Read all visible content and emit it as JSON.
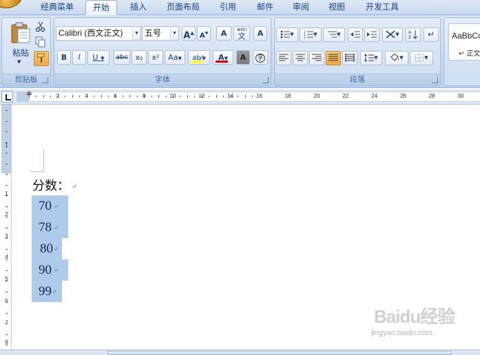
{
  "tabs": [
    {
      "label": "经典菜单",
      "active": false
    },
    {
      "label": "开始",
      "active": true
    },
    {
      "label": "插入",
      "active": false
    },
    {
      "label": "页面布局",
      "active": false
    },
    {
      "label": "引用",
      "active": false
    },
    {
      "label": "邮件",
      "active": false
    },
    {
      "label": "审阅",
      "active": false
    },
    {
      "label": "视图",
      "active": false
    },
    {
      "label": "开发工具",
      "active": false
    }
  ],
  "clipboard": {
    "group_label": "剪贴板",
    "paste_label": "粘贴",
    "icons": [
      "paste-icon",
      "cut-icon",
      "copy-icon",
      "format-painter-icon"
    ]
  },
  "font": {
    "group_label": "字体",
    "font_name": "Calibri (西文正文)",
    "font_size": "五号",
    "grow_label": "A",
    "shrink_label": "A",
    "clear_format_label": "A",
    "phonetic_label": "文",
    "phonetic_top": "wén",
    "border_char_label": "A",
    "bold_label": "B",
    "italic_label": "I",
    "underline_label": "U",
    "strike_label": "abc",
    "subscript_label": "x₂",
    "superscript_label": "x²",
    "case_label": "Aa",
    "highlight_label": "ab⁄",
    "font_color_label": "A",
    "shading_label": "A",
    "enclose_label": "字",
    "highlight_color": "#ffff00",
    "font_color": "#e00000"
  },
  "paragraph": {
    "group_label": "段落"
  },
  "styles": {
    "sample_text": "AaBbCc",
    "sub_text": "↵ 正文"
  },
  "ruler": {
    "h_numbers": [
      "2",
      "4",
      "6",
      "8",
      "10",
      "12",
      "14",
      "16",
      "18",
      "20",
      "22",
      "24",
      "26",
      "28",
      "30"
    ],
    "v_numbers": [
      "1",
      "1",
      "2",
      "3",
      "4",
      "5",
      "6",
      "7",
      "8"
    ]
  },
  "document": {
    "heading": "分数：",
    "scores": [
      "70",
      "78",
      "80",
      "90",
      "99"
    ]
  },
  "watermark": {
    "brand": "Baidu经验",
    "url": "jingyan.baidu.com"
  }
}
